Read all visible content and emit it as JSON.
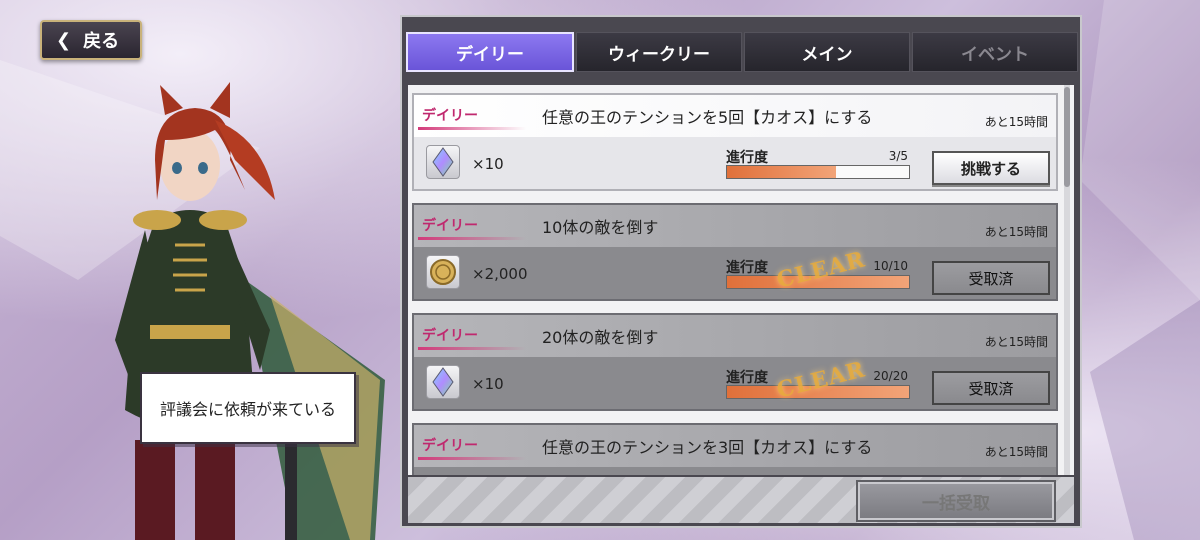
{
  "header": {
    "back_label": "戻る"
  },
  "speech": {
    "text": "評議会に依頼が来ている"
  },
  "tabs": [
    {
      "label": "デイリー",
      "state": "active"
    },
    {
      "label": "ウィークリー",
      "state": "normal"
    },
    {
      "label": "メイン",
      "state": "normal"
    },
    {
      "label": "イベント",
      "state": "disabled"
    }
  ],
  "missions": [
    {
      "tag": "デイリー",
      "title": "任意の王のテンションを5回【カオス】にする",
      "remaining": "あと15時間",
      "reward_icon": "rainbow-crystal-icon",
      "reward_amount": "×10",
      "progress_label": "進行度",
      "progress_text": "3/5",
      "progress": 0.6,
      "cleared": false,
      "button": "挑戦する"
    },
    {
      "tag": "デイリー",
      "title": "10体の敵を倒す",
      "remaining": "あと15時間",
      "reward_icon": "gold-coin-icon",
      "reward_amount": "×2,000",
      "progress_label": "進行度",
      "progress_text": "10/10",
      "progress": 1.0,
      "cleared": true,
      "clear_stamp": "CLEAR",
      "button": "受取済"
    },
    {
      "tag": "デイリー",
      "title": "20体の敵を倒す",
      "remaining": "あと15時間",
      "reward_icon": "rainbow-crystal-icon",
      "reward_amount": "×10",
      "progress_label": "進行度",
      "progress_text": "20/20",
      "progress": 1.0,
      "cleared": true,
      "clear_stamp": "CLEAR",
      "button": "受取済"
    },
    {
      "tag": "デイリー",
      "title": "任意の王のテンションを3回【カオス】にする",
      "remaining": "あと15時間"
    }
  ],
  "footer": {
    "claim_all_label": "一括受取"
  },
  "colors": {
    "active_tab": "#7b66e6",
    "tag": "#c0286e",
    "progress_fill": "#e0703a",
    "clear_stamp": "#e6aa3c"
  }
}
